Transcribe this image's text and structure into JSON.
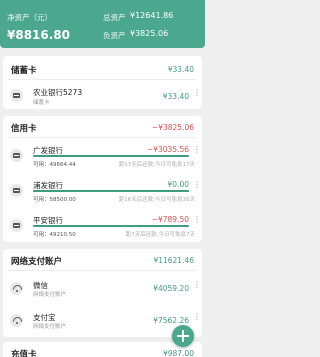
{
  "summary": {
    "net_label": "净资产（元）",
    "net_value": "¥8816.80",
    "total_label": "总资产",
    "total_value": "¥12641.86",
    "liab_label": "负资产",
    "liab_value": "¥3825.06"
  },
  "savings": {
    "title": "储蓄卡",
    "total": "¥33.40",
    "items": [
      {
        "name": "农业银行5273",
        "sub": "储蓄卡",
        "amount": "¥33.40"
      }
    ]
  },
  "credit": {
    "title": "信用卡",
    "total": "−¥3825.06",
    "items": [
      {
        "name": "广发银行",
        "amount": "−¥3035.56",
        "avail": "可用：49664.44",
        "note": "距17天后还款,今日可免息17天"
      },
      {
        "name": "浦发银行",
        "amount": "¥0.00",
        "avail": "可用：58500.00",
        "note": "距16天后还款,今日可免息16天"
      },
      {
        "name": "平安银行",
        "amount": "−¥789.50",
        "avail": "可用：49210.50",
        "note": "距7天后还款,今日可免息7天"
      }
    ]
  },
  "online": {
    "title": "网络支付账户",
    "total": "¥11621.46",
    "items": [
      {
        "name": "微信",
        "sub": "网络支付账户",
        "amount": "¥4059.20"
      },
      {
        "name": "支付宝",
        "sub": "网络支付账户",
        "amount": "¥7562.26"
      }
    ]
  },
  "stored": {
    "title": "充值卡",
    "total": "¥987.00"
  },
  "colors": {
    "accent": "#4ba78e",
    "negative": "#d9534f"
  },
  "icons": {
    "bank_card": "bank-card-icon",
    "wallet": "wallet-icon",
    "add": "add-icon",
    "more": "more-vertical-icon"
  }
}
